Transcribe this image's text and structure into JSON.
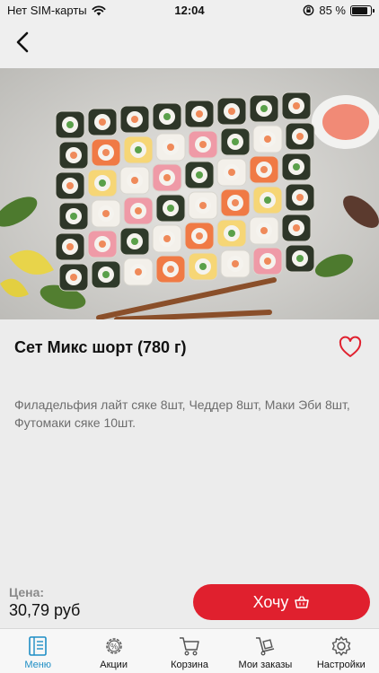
{
  "status": {
    "carrier": "Нет SIM-карты",
    "time": "12:04",
    "battery": "85 %",
    "battery_level": 0.85
  },
  "product": {
    "title": "Сет Микс шорт (780 г)",
    "description": "Филадельфия лайт сяке 8шт, Чеддер 8шт, Маки Эби 8шт, Футомаки сяке 10шт."
  },
  "price": {
    "label": "Цена:",
    "value": "30,79 руб"
  },
  "cta": {
    "label": "Хочу"
  },
  "tabs": [
    {
      "label": "Меню",
      "icon": "menu-book-icon",
      "active": true
    },
    {
      "label": "Акции",
      "icon": "discount-gear-icon",
      "active": false
    },
    {
      "label": "Корзина",
      "icon": "cart-icon",
      "active": false
    },
    {
      "label": "Мои заказы",
      "icon": "hand-truck-icon",
      "active": false
    },
    {
      "label": "Настройки",
      "icon": "gear-icon",
      "active": false
    }
  ],
  "colors": {
    "accent": "#e0202e",
    "tab_active": "#1e8ec5"
  }
}
